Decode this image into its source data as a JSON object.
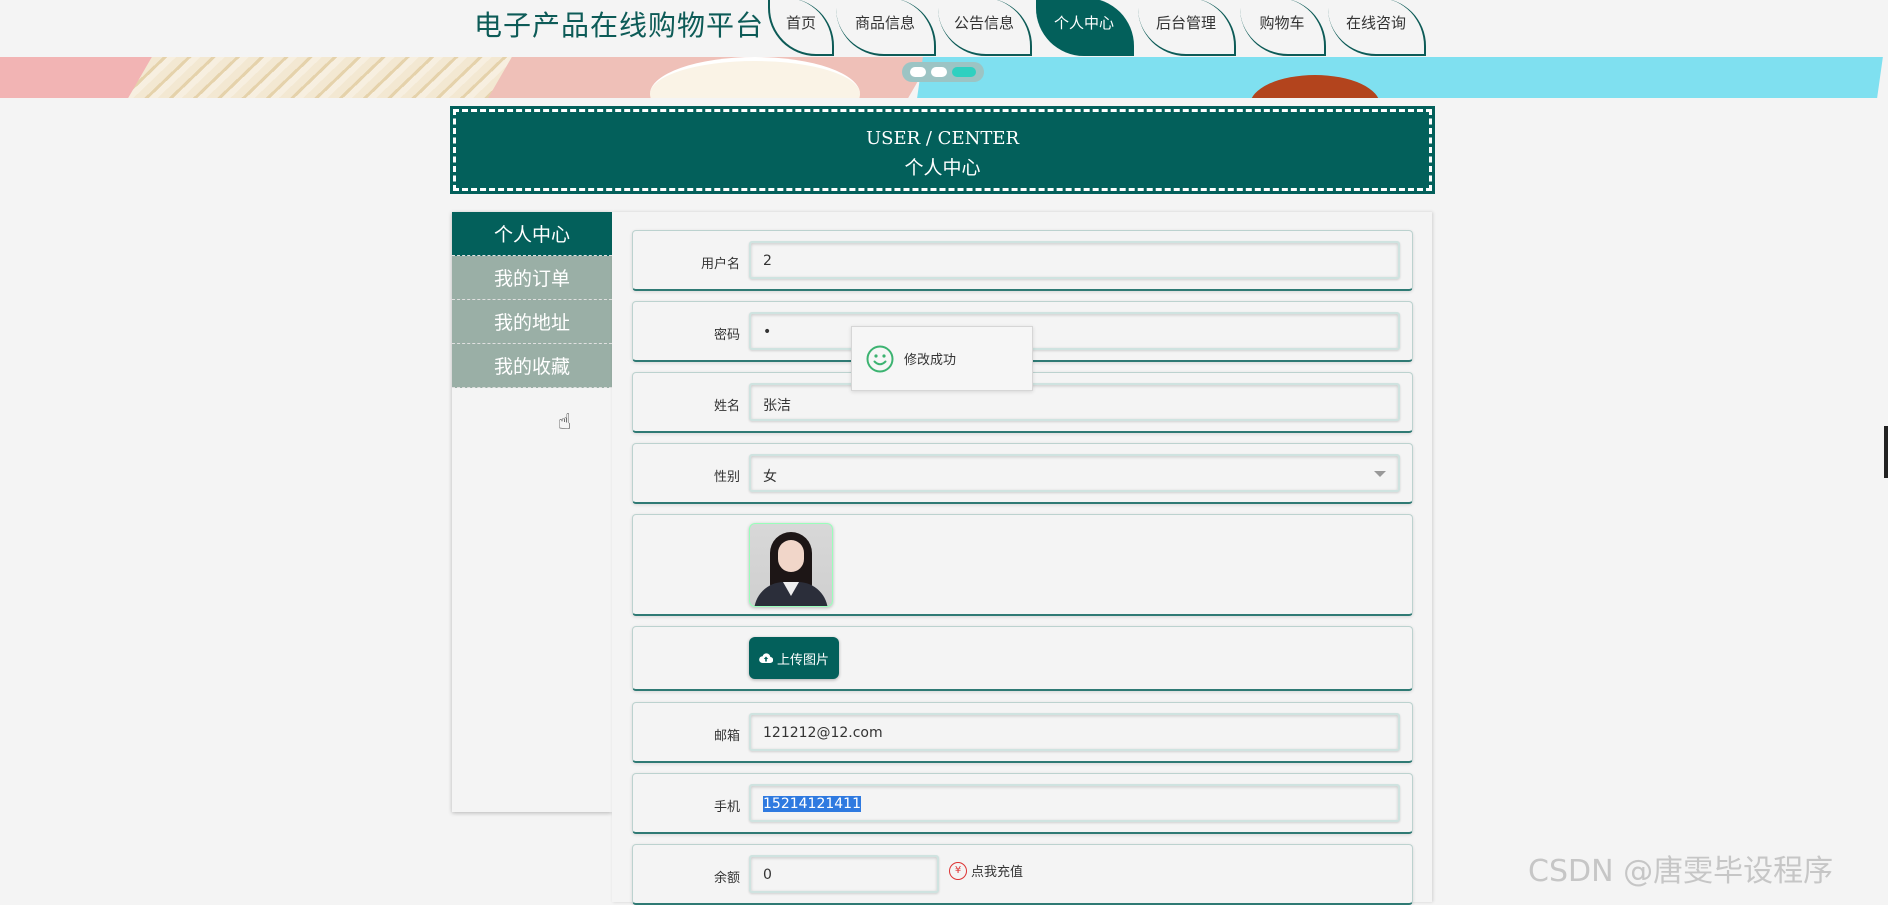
{
  "site": {
    "title": "电子产品在线购物平台"
  },
  "nav": {
    "items": [
      {
        "label": "首页"
      },
      {
        "label": "商品信息"
      },
      {
        "label": "公告信息"
      },
      {
        "label": "个人中心"
      },
      {
        "label": "后台管理"
      },
      {
        "label": "购物车"
      },
      {
        "label": "在线咨询"
      }
    ],
    "active_index": 3
  },
  "carousel": {
    "slide_count": 3,
    "active_slide": 3
  },
  "heading": {
    "en": "USER / CENTER",
    "cn": "个人中心"
  },
  "sidebar": {
    "items": [
      {
        "label": "个人中心"
      },
      {
        "label": "我的订单"
      },
      {
        "label": "我的地址"
      },
      {
        "label": "我的收藏"
      }
    ],
    "active_index": 0
  },
  "form": {
    "username": {
      "label": "用户名",
      "value": "2"
    },
    "password": {
      "label": "密码",
      "value": "•"
    },
    "name": {
      "label": "姓名",
      "value": "张洁"
    },
    "gender": {
      "label": "性别",
      "value": "女"
    },
    "upload": {
      "label": "上传图片",
      "icon": "cloud-upload-icon"
    },
    "email": {
      "label": "邮箱",
      "value": "121212@12.com"
    },
    "phone": {
      "label": "手机",
      "value": "15214121411"
    },
    "balance": {
      "label": "余额",
      "value": "0",
      "recharge_label": "点我充值",
      "recharge_icon": "¥"
    }
  },
  "toast": {
    "message": "修改成功",
    "icon": "smile-icon"
  },
  "watermark": "CSDN @唐雯毕设程序",
  "colors": {
    "primary": "#03605b",
    "sidebar_inactive": "#9aafa6",
    "selection": "#2f7ae0"
  }
}
